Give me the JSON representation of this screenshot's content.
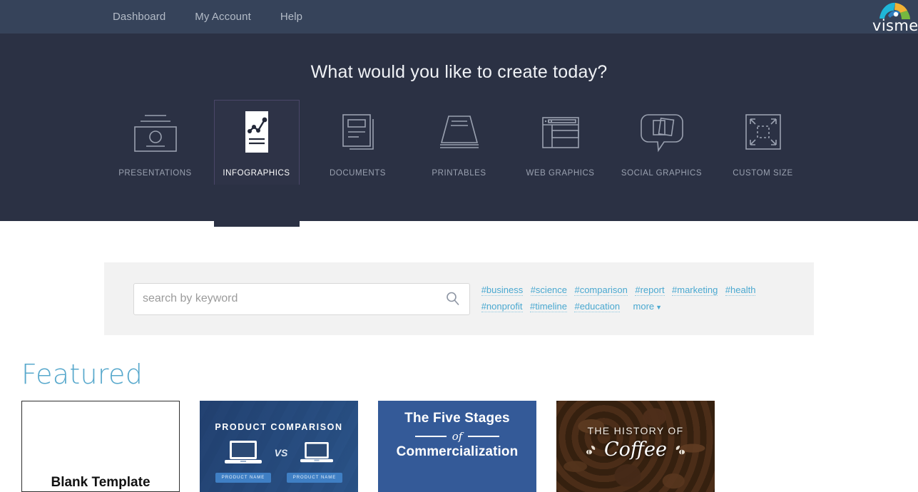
{
  "nav": {
    "links": [
      {
        "label": "Dashboard",
        "name": "nav-link-dashboard"
      },
      {
        "label": "My Account",
        "name": "nav-link-my-account"
      },
      {
        "label": "Help",
        "name": "nav-link-help"
      }
    ],
    "logo_text": "visme",
    "logo_icon": "visme-fan-logo-icon"
  },
  "hero": {
    "title": "What would you like to create today?",
    "categories": [
      {
        "label": "PRESENTATIONS",
        "icon": "presentation-slide-icon",
        "active": false
      },
      {
        "label": "INFOGRAPHICS",
        "icon": "infographic-chart-icon",
        "active": true
      },
      {
        "label": "DOCUMENTS",
        "icon": "documents-pages-icon",
        "active": false
      },
      {
        "label": "PRINTABLES",
        "icon": "printable-page-icon",
        "active": false
      },
      {
        "label": "WEB GRAPHICS",
        "icon": "browser-window-icon",
        "active": false
      },
      {
        "label": "SOCIAL GRAPHICS",
        "icon": "speech-bubble-photos-icon",
        "active": false
      },
      {
        "label": "CUSTOM SIZE",
        "icon": "resize-arrows-icon",
        "active": false
      }
    ]
  },
  "search": {
    "placeholder": "search by keyword",
    "value": "",
    "icon": "search-icon",
    "tags": [
      "#business",
      "#science",
      "#comparison",
      "#report",
      "#marketing",
      "#health",
      "#nonprofit",
      "#timeline",
      "#education"
    ],
    "more_label": "more",
    "more_caret": "▼"
  },
  "featured": {
    "title": "Featured",
    "cards": [
      {
        "kind": "blank",
        "title": "Blank Template"
      },
      {
        "kind": "product",
        "title": "PRODUCT COMPARISON",
        "vs": "VS",
        "button_left": "PRODUCT NAME",
        "button_right": "PRODUCT NAME"
      },
      {
        "kind": "five-stages",
        "line1": "The Five Stages",
        "connector": "of",
        "line2": "Commercialization"
      },
      {
        "kind": "coffee",
        "line1": "THE HISTORY OF",
        "line2": "Coffee"
      }
    ]
  },
  "colors": {
    "nav_bg": "#36435a",
    "hero_bg": "#2b3144",
    "accent_blue": "#4aa8d0",
    "featured_blue": "#57a8cc",
    "panel_bg": "#f2f2f2"
  }
}
